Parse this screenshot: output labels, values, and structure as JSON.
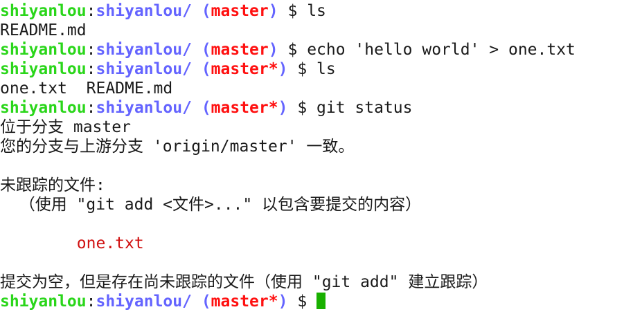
{
  "prompt": {
    "user": "shiyanlou",
    "sep": ":",
    "path": "shiyanlou/",
    "dollar": "$"
  },
  "colors": {
    "user": "#2ad61a",
    "path": "#6464ff",
    "branch": "#ff1010",
    "untracked": "#d01010",
    "cursor": "#19b000"
  },
  "lines": [
    {
      "type": "prompt",
      "branch": "master",
      "command": "ls"
    },
    {
      "type": "output",
      "text": "README.md"
    },
    {
      "type": "prompt",
      "branch": "master",
      "command": "echo 'hello world' > one.txt"
    },
    {
      "type": "prompt",
      "branch": "master*",
      "command": "ls"
    },
    {
      "type": "output",
      "text": "one.txt  README.md"
    },
    {
      "type": "prompt",
      "branch": "master*",
      "command": "git status"
    },
    {
      "type": "output",
      "text": "位于分支 master"
    },
    {
      "type": "output",
      "text": "您的分支与上游分支 'origin/master' 一致。"
    },
    {
      "type": "output",
      "text": ""
    },
    {
      "type": "output",
      "text": "未跟踪的文件:"
    },
    {
      "type": "output",
      "text": "  （使用 \"git add <文件>...\" 以包含要提交的内容）"
    },
    {
      "type": "output",
      "text": ""
    },
    {
      "type": "untracked",
      "text": "\tone.txt"
    },
    {
      "type": "output",
      "text": ""
    },
    {
      "type": "output",
      "text": "提交为空，但是存在尚未跟踪的文件（使用 \"git add\" 建立跟踪）"
    },
    {
      "type": "prompt",
      "branch": "master*",
      "command": "",
      "cursor": true
    }
  ]
}
